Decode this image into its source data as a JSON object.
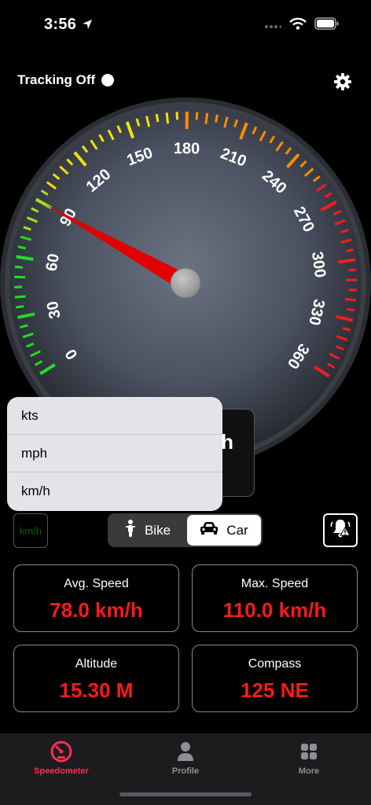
{
  "status_bar": {
    "time": "3:56"
  },
  "tracking": {
    "label": "Tracking Off"
  },
  "speedometer": {
    "labels": [
      "0",
      "30",
      "60",
      "90",
      "120",
      "150",
      "180",
      "210",
      "240",
      "270",
      "300",
      "330",
      "360"
    ],
    "needle_speed": 90,
    "max_speed": 360
  },
  "speed_display": {
    "visible_text": "h"
  },
  "unit_menu": {
    "options": [
      "kts",
      "mph",
      "km/h"
    ]
  },
  "unit_toggle": {
    "label": "km/h"
  },
  "mode_segment": {
    "bike_label": "Bike",
    "car_label": "Car",
    "selected": "Car"
  },
  "stats": {
    "avg": {
      "label": "Avg. Speed",
      "value": "78.0 km/h"
    },
    "max": {
      "label": "Max. Speed",
      "value": "110.0 km/h"
    },
    "altitude": {
      "label": "Altitude",
      "value": "15.30 M"
    },
    "compass": {
      "label": "Compass",
      "value": "125 NE"
    }
  },
  "tab_bar": {
    "speedometer": "Speedometer",
    "profile": "Profile",
    "more": "More"
  },
  "colors": {
    "accent": "#ff2d55",
    "value_red": "#ff1a1a",
    "needle": "#e00000"
  }
}
